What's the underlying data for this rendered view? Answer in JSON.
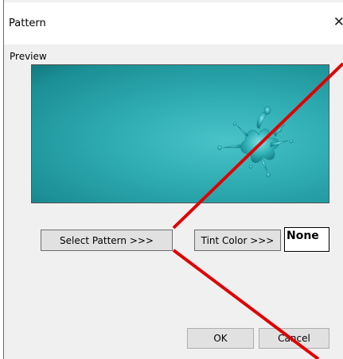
{
  "window": {
    "title": "Pattern",
    "close_glyph": "✕"
  },
  "preview": {
    "label": "Preview"
  },
  "buttons": {
    "select_pattern": "Select Pattern >>>",
    "tint_color": "Tint Color >>>",
    "ok": "OK",
    "cancel": "Cancel"
  },
  "tint": {
    "value": "None"
  },
  "colors": {
    "annotation": "#e00000",
    "preview_teal": "#2aa7ad"
  }
}
